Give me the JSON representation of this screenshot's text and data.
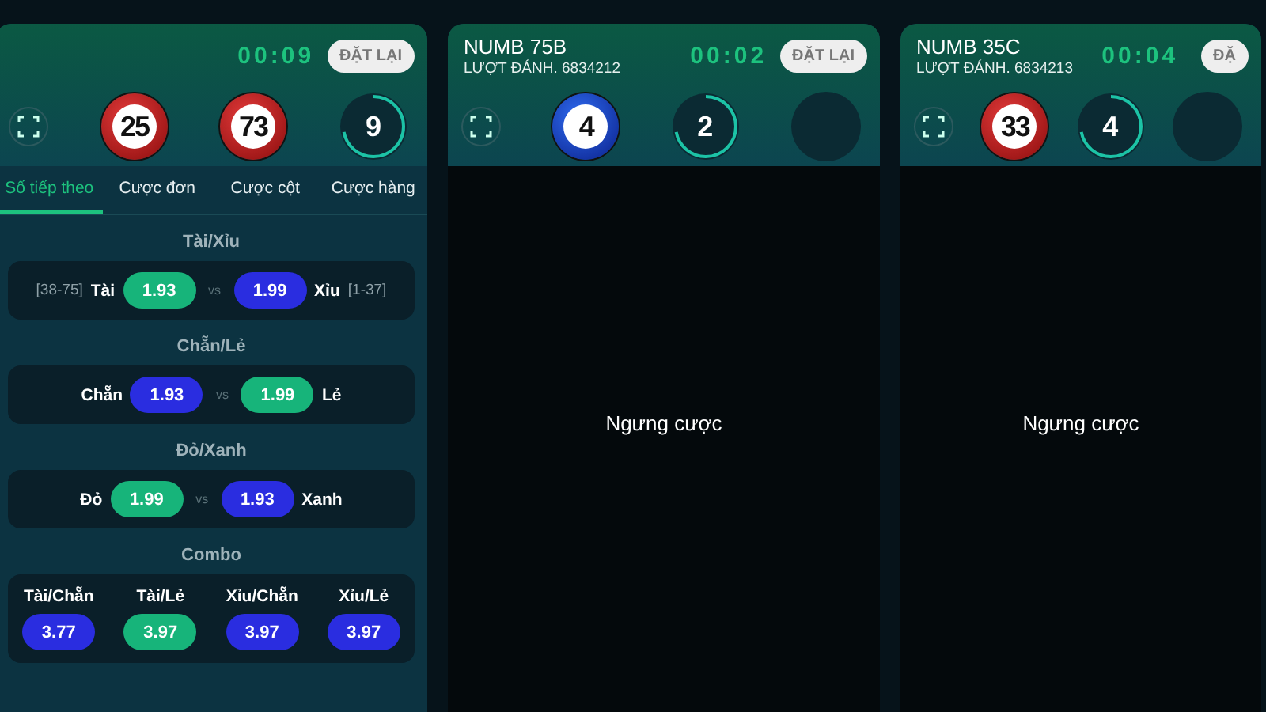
{
  "panels": [
    {
      "timer": "00:09",
      "reset_label": "ĐẶT LẠI",
      "suspended": false,
      "balls": [
        {
          "kind": "red",
          "label": "25"
        },
        {
          "kind": "red",
          "label": "73"
        },
        {
          "kind": "ring",
          "label": "9"
        }
      ],
      "tabs": [
        {
          "label": "Số tiếp theo",
          "selected": true
        },
        {
          "label": "Cược đơn",
          "selected": false
        },
        {
          "label": "Cược cột",
          "selected": false
        },
        {
          "label": "Cược hàng",
          "selected": false
        }
      ],
      "sections": [
        {
          "heading": "Tài/Xỉu",
          "left_range": "[38-75]",
          "left_label": "Tài",
          "left_odds": {
            "value": "1.93",
            "color": "#17b47a"
          },
          "vs": "vs",
          "right_odds": {
            "value": "1.99",
            "color": "#2a2de0"
          },
          "right_label": "Xỉu",
          "right_range": "[1-37]"
        },
        {
          "heading": "Chẵn/Lẻ",
          "left_label": "Chẵn",
          "left_odds": {
            "value": "1.93",
            "color": "#2a2de0"
          },
          "vs": "vs",
          "right_odds": {
            "value": "1.99",
            "color": "#17b47a"
          },
          "right_label": "Lẻ"
        },
        {
          "heading": "Đỏ/Xanh",
          "left_label": "Đỏ",
          "left_odds": {
            "value": "1.99",
            "color": "#17b47a"
          },
          "vs": "vs",
          "right_odds": {
            "value": "1.93",
            "color": "#2a2de0"
          },
          "right_label": "Xanh"
        }
      ],
      "combo": {
        "heading": "Combo",
        "items": [
          {
            "label": "Tài/Chẵn",
            "value": "3.77",
            "color": "#2a2de0"
          },
          {
            "label": "Tài/Lẻ",
            "value": "3.97",
            "color": "#17b47a"
          },
          {
            "label": "Xỉu/Chẵn",
            "value": "3.97",
            "color": "#2a2de0"
          },
          {
            "label": "Xỉu/Lẻ",
            "value": "3.97",
            "color": "#2a2de0"
          }
        ]
      }
    },
    {
      "title": "NUMB 75B",
      "round": "LƯỢT ĐÁNH. 6834212",
      "timer": "00:02",
      "reset_label": "ĐẶT LẠI",
      "suspended": true,
      "overlay_text": "Ngưng cược",
      "balls": [
        {
          "kind": "blue",
          "label": "4"
        },
        {
          "kind": "ring",
          "label": "2"
        },
        {
          "kind": "empty"
        }
      ]
    },
    {
      "title": "NUMB 35C",
      "round": "LƯỢT ĐÁNH. 6834213",
      "timer": "00:04",
      "reset_label": "ĐẶ",
      "suspended": true,
      "overlay_text": "Ngưng cược",
      "balls": [
        {
          "kind": "red",
          "label": "33"
        },
        {
          "kind": "ring",
          "label": "4"
        },
        {
          "kind": "empty"
        }
      ]
    }
  ]
}
